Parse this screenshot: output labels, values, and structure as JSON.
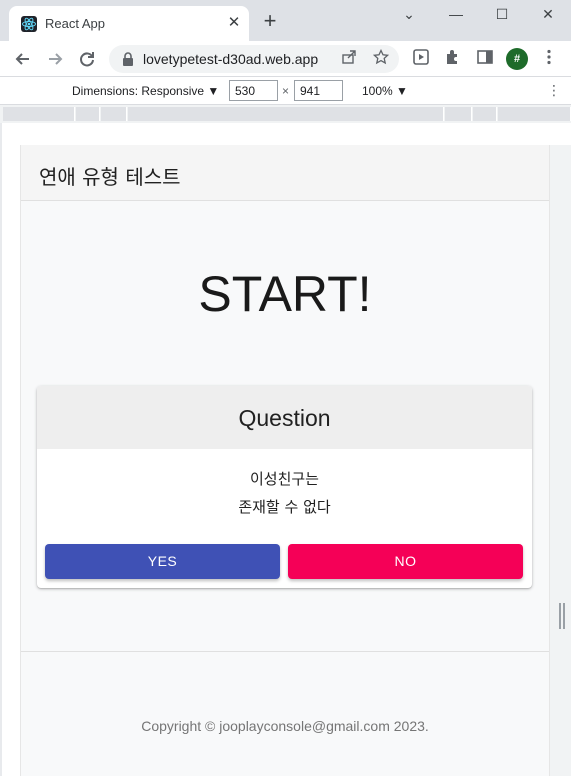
{
  "browser": {
    "tab_title": "React App",
    "tab_close": "✕",
    "new_tab": "+",
    "window_controls": {
      "dropdown": "⌄",
      "minimize": "—",
      "maximize": "☐",
      "close": "✕"
    },
    "url": "lovetypetest-d30ad.web.app",
    "profile_initial": "#",
    "icons": [
      "back-icon",
      "forward-icon",
      "reload-icon",
      "lock-icon",
      "share-icon",
      "star-icon",
      "media-icon",
      "extensions-icon",
      "side-panel-icon",
      "menu-icon"
    ]
  },
  "devtools": {
    "dimensions_label": "Dimensions: Responsive ▼",
    "width": "530",
    "height": "941",
    "times": "×",
    "zoom": "100% ▼",
    "more": "⋮"
  },
  "app": {
    "title": "연애 유형 테스트",
    "heading": "START!",
    "question_header": "Question",
    "question_line1": "이성친구는",
    "question_line2": "존재할 수 없다",
    "yes_label": "YES",
    "no_label": "NO",
    "footer": "Copyright © jooplayconsole@gmail.com 2023."
  },
  "colors": {
    "yes_button": "#3f51b5",
    "no_button": "#f50057",
    "profile": "#1e6b2a"
  }
}
